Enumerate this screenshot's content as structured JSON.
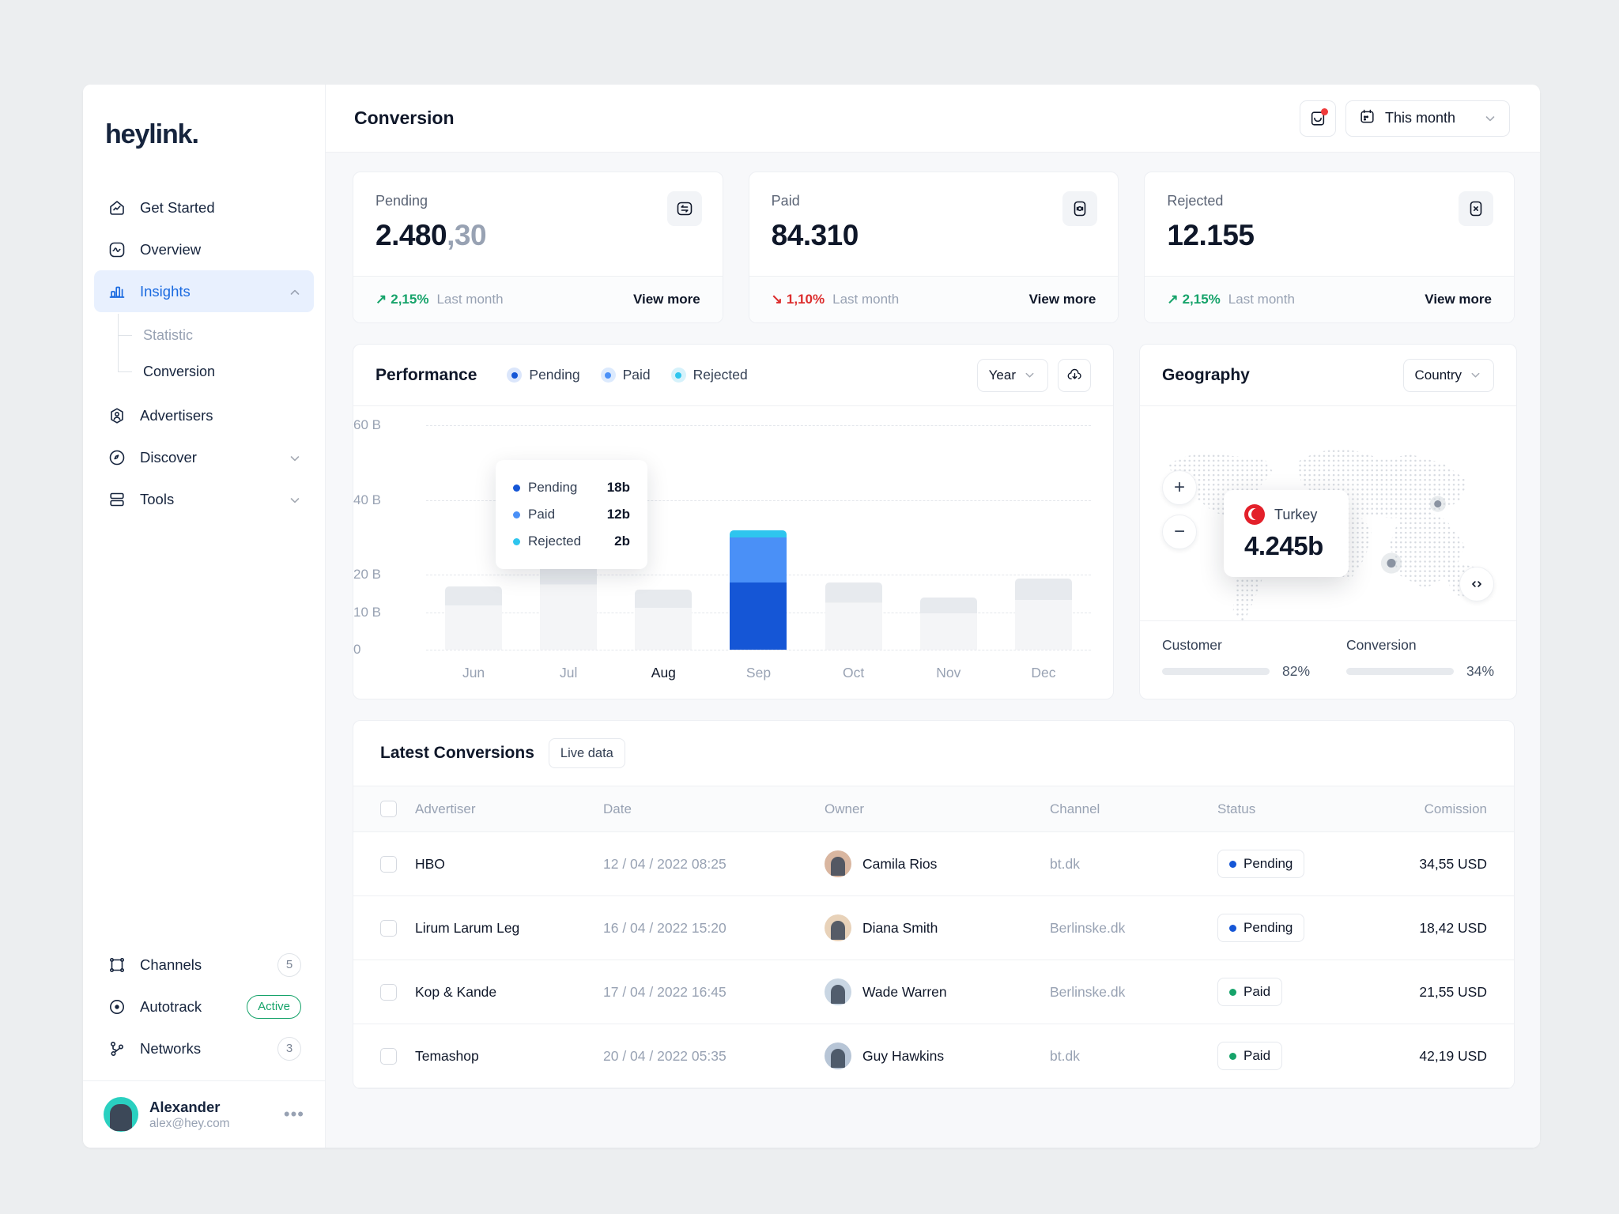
{
  "brand": {
    "logo": "heylink."
  },
  "sidebar": {
    "items": [
      {
        "label": "Get Started",
        "icon": "home-chart-icon",
        "active": false
      },
      {
        "label": "Overview",
        "icon": "activity-square-icon",
        "active": false
      },
      {
        "label": "Insights",
        "icon": "bar-chart-icon",
        "active": true,
        "expanded": true
      },
      {
        "label": "Advertisers",
        "icon": "user-hex-icon",
        "active": false
      },
      {
        "label": "Discover",
        "icon": "compass-icon",
        "active": false,
        "collapsible": true
      },
      {
        "label": "Tools",
        "icon": "layers-icon",
        "active": false,
        "collapsible": true
      }
    ],
    "sub_items": [
      {
        "label": "Statistic",
        "active": false
      },
      {
        "label": "Conversion",
        "active": true
      }
    ],
    "bottom_items": [
      {
        "label": "Channels",
        "icon": "frame-icon",
        "badge": "5",
        "badge_type": "count"
      },
      {
        "label": "Autotrack",
        "icon": "target-icon",
        "badge": "Active",
        "badge_type": "active"
      },
      {
        "label": "Networks",
        "icon": "network-icon",
        "badge": "3",
        "badge_type": "count"
      }
    ],
    "user": {
      "name": "Alexander",
      "email": "alex@hey.com",
      "menu": "•••"
    }
  },
  "topbar": {
    "title": "Conversion",
    "notification_icon": "inbox-icon",
    "date_filter": {
      "label": "This month",
      "icon": "calendar-icon"
    }
  },
  "stats": [
    {
      "label": "Pending",
      "value_main": "2.480",
      "value_dec": ",30",
      "icon": "transfer-icon",
      "delta": "2,15%",
      "delta_dir": "up",
      "delta_arrow": "↗",
      "delta_label": "Last month",
      "link": "View more"
    },
    {
      "label": "Paid",
      "value_main": "84.310",
      "value_dec": "",
      "icon": "money-icon",
      "delta": "1,10%",
      "delta_dir": "down",
      "delta_arrow": "↘",
      "delta_label": "Last month",
      "link": "View more"
    },
    {
      "label": "Rejected",
      "value_main": "12.155",
      "value_dec": "",
      "icon": "close-box-icon",
      "delta": "2,15%",
      "delta_dir": "up",
      "delta_arrow": "↗",
      "delta_label": "Last month",
      "link": "View more"
    }
  ],
  "performance": {
    "title": "Performance",
    "legend": [
      {
        "label": "Pending",
        "color": "#1556d6"
      },
      {
        "label": "Paid",
        "color": "#4a90f7"
      },
      {
        "label": "Rejected",
        "color": "#2ec5ee"
      }
    ],
    "range_select": "Year",
    "download_icon": "cloud-download-icon",
    "tooltip": {
      "rows": [
        {
          "label": "Pending",
          "value": "18b",
          "color": "#1556d6"
        },
        {
          "label": "Paid",
          "value": "12b",
          "color": "#4a90f7"
        },
        {
          "label": "Rejected",
          "value": "2b",
          "color": "#2ec5ee"
        }
      ]
    }
  },
  "geography": {
    "title": "Geography",
    "select": "Country",
    "tooltip": {
      "country": "Turkey",
      "value": "4.245b",
      "flag": "turkey-flag-icon"
    },
    "zoom_in": "+",
    "zoom_out": "−",
    "code_icon": "code-icon",
    "metrics": [
      {
        "label": "Customer",
        "percent": "82%",
        "value": 82,
        "color": "#1a6ae0"
      },
      {
        "label": "Conversion",
        "percent": "34%",
        "value": 34,
        "color": "#8b3fe8"
      }
    ]
  },
  "table": {
    "title": "Latest Conversions",
    "live_badge": "Live data",
    "columns": [
      "Advertiser",
      "Date",
      "Owner",
      "Channel",
      "Status",
      "Comission"
    ],
    "rows": [
      {
        "advertiser": "HBO",
        "date": "12 / 04 / 2022 08:25",
        "owner": "Camila Rios",
        "avatar_color": "#d9b6a0",
        "channel": "bt.dk",
        "status": "Pending",
        "status_color": "#1556d6",
        "commission": "34,55 USD"
      },
      {
        "advertiser": "Lirum Larum Leg",
        "date": "16 / 04 / 2022 15:20",
        "owner": "Diana Smith",
        "avatar_color": "#e8d2b9",
        "channel": "Berlinske.dk",
        "status": "Pending",
        "status_color": "#1556d6",
        "commission": "18,42 USD"
      },
      {
        "advertiser": "Kop & Kande",
        "date": "17 / 04 / 2022 16:45",
        "owner": "Wade Warren",
        "avatar_color": "#c9d6e3",
        "channel": "Berlinske.dk",
        "status": "Paid",
        "status_color": "#16a36a",
        "commission": "21,55 USD"
      },
      {
        "advertiser": "Temashop",
        "date": "20 / 04 / 2022 05:35",
        "owner": "Guy Hawkins",
        "avatar_color": "#b7c5d6",
        "channel": "bt.dk",
        "status": "Paid",
        "status_color": "#16a36a",
        "commission": "42,19 USD"
      }
    ]
  },
  "chart_data": {
    "type": "bar",
    "title": "Performance",
    "categories": [
      "Jun",
      "Jul",
      "Aug",
      "Sep",
      "Oct",
      "Nov",
      "Dec"
    ],
    "series": [
      {
        "name": "Pending",
        "color": "#1556d6",
        "values": [
          null,
          null,
          null,
          18,
          null,
          null,
          null
        ]
      },
      {
        "name": "Paid",
        "color": "#4a90f7",
        "values": [
          null,
          null,
          null,
          12,
          null,
          null,
          null
        ]
      },
      {
        "name": "Rejected",
        "color": "#2ec5ee",
        "values": [
          null,
          null,
          null,
          2,
          null,
          null,
          null
        ]
      }
    ],
    "totals": [
      17,
      25,
      16,
      32,
      18,
      14,
      19
    ],
    "highlighted_category": "Sep",
    "ytick_labels": [
      "60 B",
      "40 B",
      "20 B",
      "10 B",
      "0"
    ],
    "ytick_values": [
      60,
      40,
      20,
      10,
      0
    ],
    "ylim": [
      0,
      60
    ],
    "xlabel": "",
    "ylabel": "",
    "grid": true,
    "legend_position": "top"
  }
}
